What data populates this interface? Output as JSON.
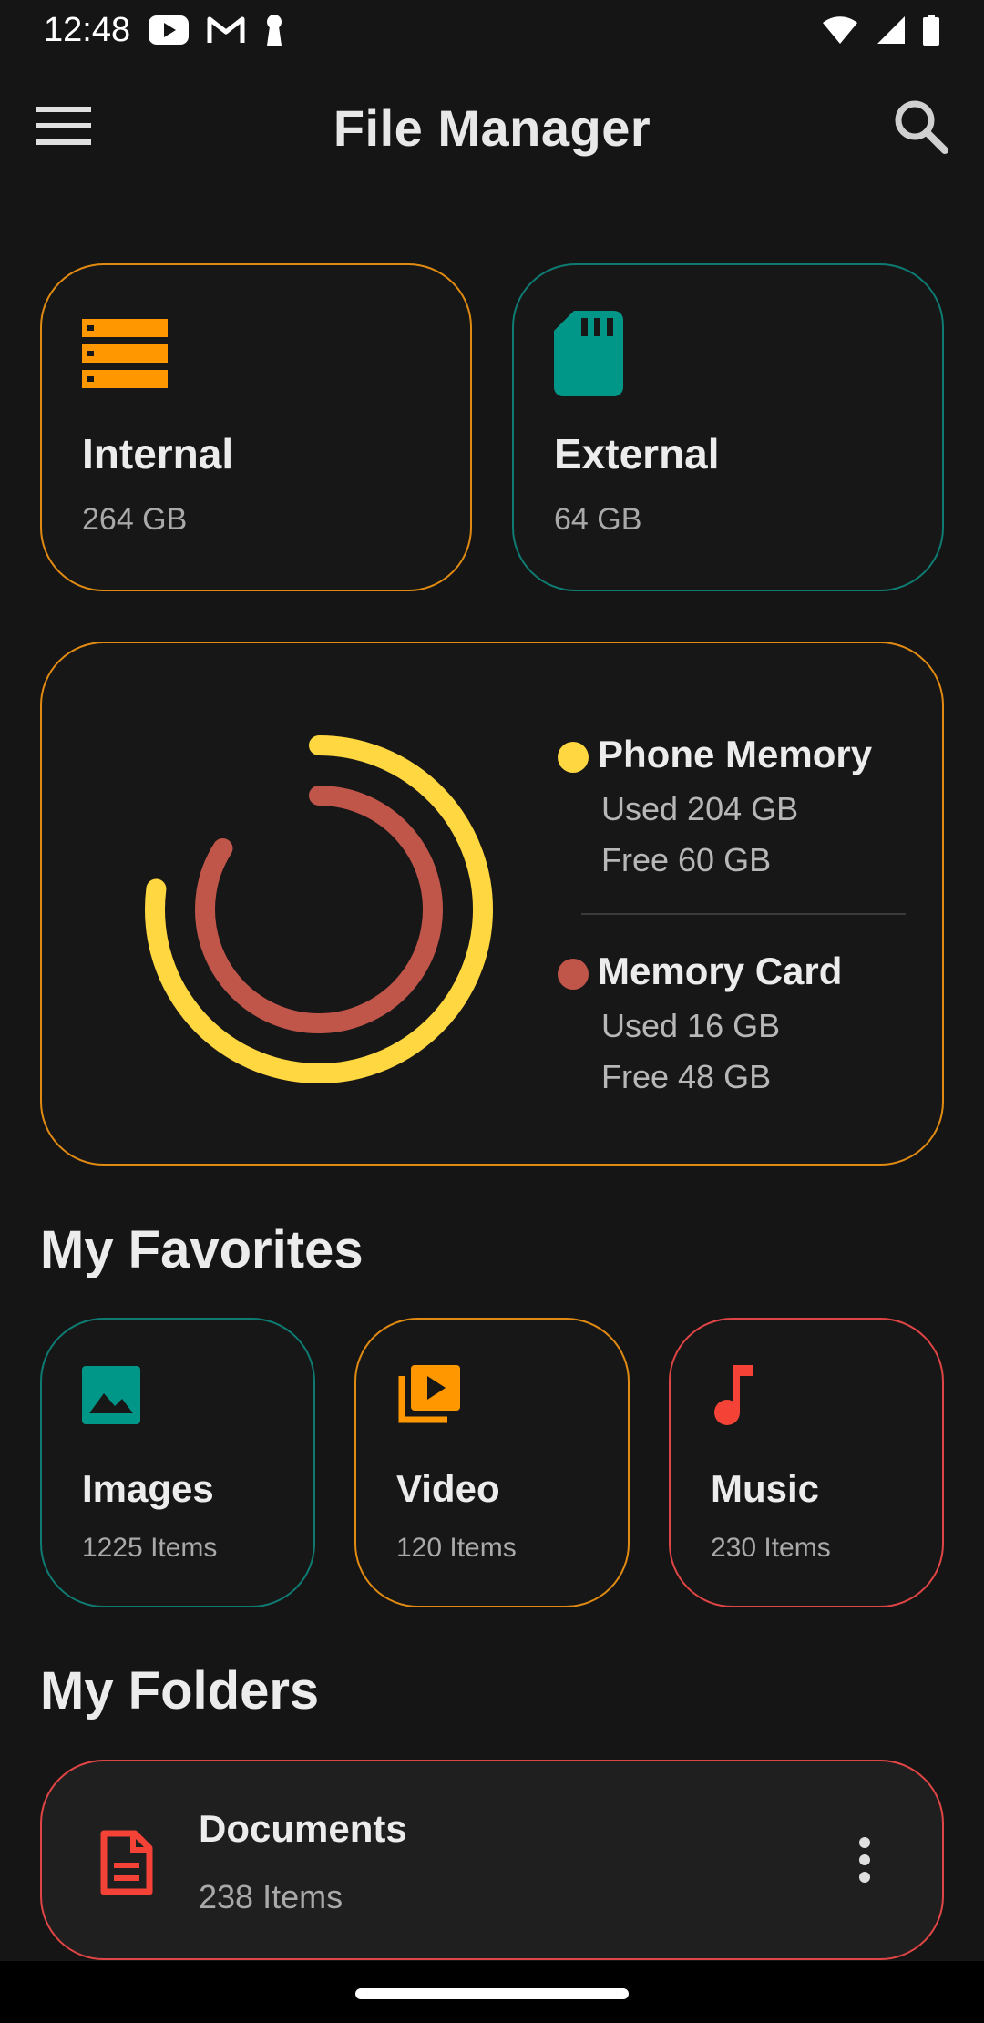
{
  "status_bar": {
    "time": "12:48"
  },
  "app_bar": {
    "title": "File Manager"
  },
  "storage": [
    {
      "name": "Internal",
      "size": "264 GB",
      "icon": "storage-icon",
      "color": "#ff9800"
    },
    {
      "name": "External",
      "size": "64 GB",
      "icon": "sd-card-icon",
      "color": "#009688"
    }
  ],
  "usage": {
    "phone": {
      "title": "Phone Memory",
      "used": "Used 204 GB",
      "free": "Free 60 GB",
      "color": "#ffd740",
      "used_fraction": 0.77
    },
    "card": {
      "title": "Memory Card",
      "used": "Used 16 GB",
      "free": "Free 48 GB",
      "color": "#c0554a",
      "used_fraction": 0.84
    }
  },
  "favorites": {
    "title": "My Favorites",
    "items": [
      {
        "name": "Images",
        "count": "1225 Items",
        "icon": "image-icon",
        "color": "#009688"
      },
      {
        "name": "Video",
        "count": "120 Items",
        "icon": "video-library-icon",
        "color": "#ff9800"
      },
      {
        "name": "Music",
        "count": "230 Items",
        "icon": "music-note-icon",
        "color": "#f44336"
      }
    ]
  },
  "folders": {
    "title": "My Folders",
    "items": [
      {
        "name": "Documents",
        "count": "238 Items",
        "icon": "document-icon",
        "color": "#f44336"
      }
    ]
  }
}
